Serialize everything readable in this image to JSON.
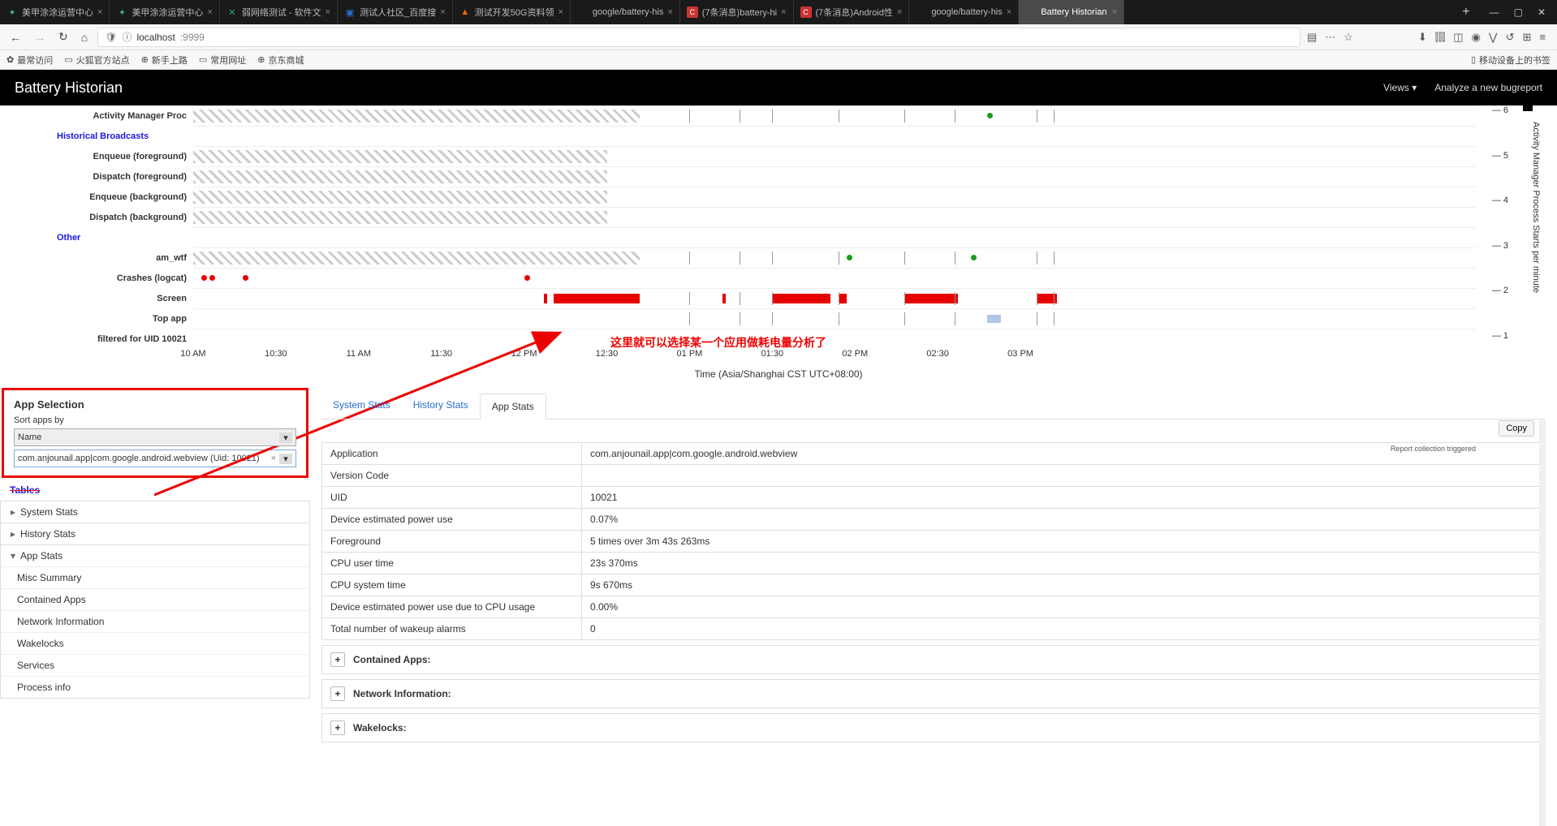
{
  "browser": {
    "tabs": [
      {
        "label": "美甲涂涂运营中心",
        "fav": "blue"
      },
      {
        "label": "美甲涂涂运营中心",
        "fav": "blue"
      },
      {
        "label": "弱网络测试 - 软件文",
        "fav": "conf"
      },
      {
        "label": "测试人社区_百度搜",
        "fav": "baidu"
      },
      {
        "label": "测试开发50G资料领",
        "fav": "fire"
      },
      {
        "label": "google/battery-his",
        "fav": "none"
      },
      {
        "label": "(7条消息)battery-hi",
        "fav": "red"
      },
      {
        "label": "(7条消息)Android性",
        "fav": "red"
      },
      {
        "label": "google/battery-his",
        "fav": "none"
      },
      {
        "label": "Battery Historian",
        "fav": "none",
        "active": true
      }
    ],
    "url_scheme": "ⓘ",
    "url_host": "localhost",
    "url_port": ":9999",
    "bookmarks": [
      "最常访问",
      "火狐官方站点",
      "新手上路",
      "常用网址",
      "京东商城"
    ],
    "bookmark_right": "移动设备上的书签"
  },
  "app": {
    "title": "Battery Historian",
    "menu_views": "Views",
    "menu_analyze": "Analyze a new bugreport"
  },
  "timeline": {
    "rows": [
      {
        "type": "label",
        "text": "Activity Manager Proc"
      },
      {
        "type": "section",
        "text": "Historical Broadcasts"
      },
      {
        "type": "label",
        "text": "Enqueue (foreground)"
      },
      {
        "type": "label",
        "text": "Dispatch (foreground)"
      },
      {
        "type": "label",
        "text": "Enqueue (background)"
      },
      {
        "type": "label",
        "text": "Dispatch (background)"
      },
      {
        "type": "section",
        "text": "Other"
      },
      {
        "type": "label",
        "text": "am_wtf"
      },
      {
        "type": "label",
        "text": "Crashes (logcat)"
      },
      {
        "type": "label",
        "text": "Screen"
      },
      {
        "type": "label",
        "text": "Top app"
      },
      {
        "type": "label",
        "text": "filtered for UID 10021"
      }
    ],
    "x_ticks": [
      "10 AM",
      "10:30",
      "11 AM",
      "11:30",
      "12 PM",
      "12:30",
      "01 PM",
      "01:30",
      "02 PM",
      "02:30",
      "03 PM"
    ],
    "x_title": "Time (Asia/Shanghai CST UTC+08:00)",
    "y_right": [
      "6",
      "5",
      "4",
      "3",
      "2",
      "1"
    ],
    "y_right_label": "Activity Manager Process Starts per minute",
    "note": "Report collection triggered",
    "annotation": "这里就可以选择某一个应用做耗电量分析了"
  },
  "chart_data": {
    "type": "timeline",
    "x_range_hours": [
      10,
      15.25
    ],
    "right_axis_range": [
      1,
      6
    ],
    "series": {
      "Activity Manager Proc": {
        "type": "hatch",
        "spans": [
          [
            10,
            12.7
          ]
        ],
        "green_dots": [
          14.8
        ]
      },
      "Enqueue (foreground)": {
        "type": "hatch",
        "spans": [
          [
            10,
            12.5
          ]
        ]
      },
      "Dispatch (foreground)": {
        "type": "hatch",
        "spans": [
          [
            10,
            12.5
          ]
        ]
      },
      "Enqueue (background)": {
        "type": "hatch",
        "spans": [
          [
            10,
            12.5
          ]
        ]
      },
      "Dispatch (background)": {
        "type": "hatch",
        "spans": [
          [
            10,
            12.5
          ]
        ]
      },
      "am_wtf": {
        "type": "hatch",
        "spans": [
          [
            10,
            12.7
          ]
        ],
        "green_dots": [
          13.95,
          14.7
        ]
      },
      "Crashes (logcat)": {
        "type": "red_dots",
        "x": [
          10.05,
          10.1,
          10.3,
          12.0
        ]
      },
      "Screen": {
        "type": "red_bars",
        "spans": [
          [
            12.12,
            12.14
          ],
          [
            12.18,
            12.7
          ],
          [
            13.2,
            13.22
          ],
          [
            13.5,
            13.85
          ],
          [
            13.9,
            13.95
          ],
          [
            14.3,
            14.62
          ],
          [
            15.1,
            15.22
          ]
        ]
      },
      "Top app": {
        "type": "blue_bars",
        "spans": [
          [
            14.8,
            14.88
          ]
        ]
      }
    }
  },
  "app_selection": {
    "title": "App Selection",
    "sort_label": "Sort apps by",
    "sort_value": "Name",
    "selected_app": "com.anjounail.app|com.google.android.webview (Uid: 10021)"
  },
  "tables": {
    "title": "Tables",
    "items": [
      {
        "label": "System Stats",
        "caret": "r"
      },
      {
        "label": "History Stats",
        "caret": "r"
      },
      {
        "label": "App Stats",
        "caret": "d"
      }
    ],
    "sub": [
      "Misc Summary",
      "Contained Apps",
      "Network Information",
      "Wakelocks",
      "Services",
      "Process info"
    ]
  },
  "stats_tabs": [
    "System Stats",
    "History Stats",
    "App Stats"
  ],
  "copy": "Copy",
  "info": [
    {
      "k": "Application",
      "v": "com.anjounail.app|com.google.android.webview"
    },
    {
      "k": "Version Code",
      "v": ""
    },
    {
      "k": "UID",
      "v": "10021"
    },
    {
      "k": "Device estimated power use",
      "v": "0.07%"
    },
    {
      "k": "Foreground",
      "v": "5 times over 3m 43s 263ms"
    },
    {
      "k": "CPU user time",
      "v": "23s 370ms"
    },
    {
      "k": "CPU system time",
      "v": "9s 670ms"
    },
    {
      "k": "Device estimated power use due to CPU usage",
      "v": "0.00%"
    },
    {
      "k": "Total number of wakeup alarms",
      "v": "0"
    }
  ],
  "expand": [
    "Contained Apps:",
    "Network Information:",
    "Wakelocks:"
  ]
}
